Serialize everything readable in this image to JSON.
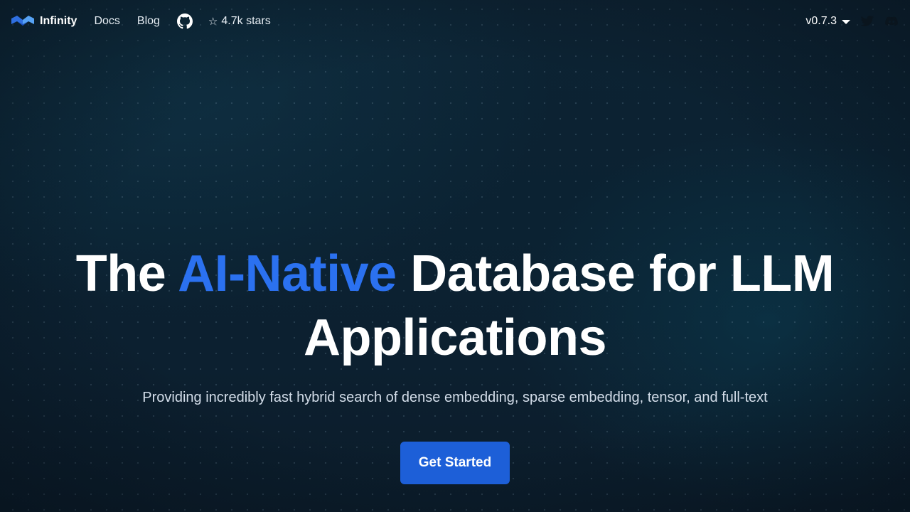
{
  "nav": {
    "brand": "Infinity",
    "links": [
      "Docs",
      "Blog"
    ],
    "github_stars": "4.7k stars",
    "version": "v0.7.3"
  },
  "hero": {
    "title_pre": "The ",
    "title_accent": "AI-Native",
    "title_post": " Database for LLM Applications",
    "subtitle": "Providing incredibly fast hybrid search of dense embedding, sparse embedding, tensor, and full-text",
    "cta_label": "Get Started"
  },
  "colors": {
    "accent": "#2b71f0",
    "cta_background": "#1d5fd8",
    "background": "#0c2030"
  },
  "icons": [
    "infinity-logo-icon",
    "github-icon",
    "star-icon",
    "caret-down-icon",
    "twitter-icon",
    "discord-icon"
  ]
}
